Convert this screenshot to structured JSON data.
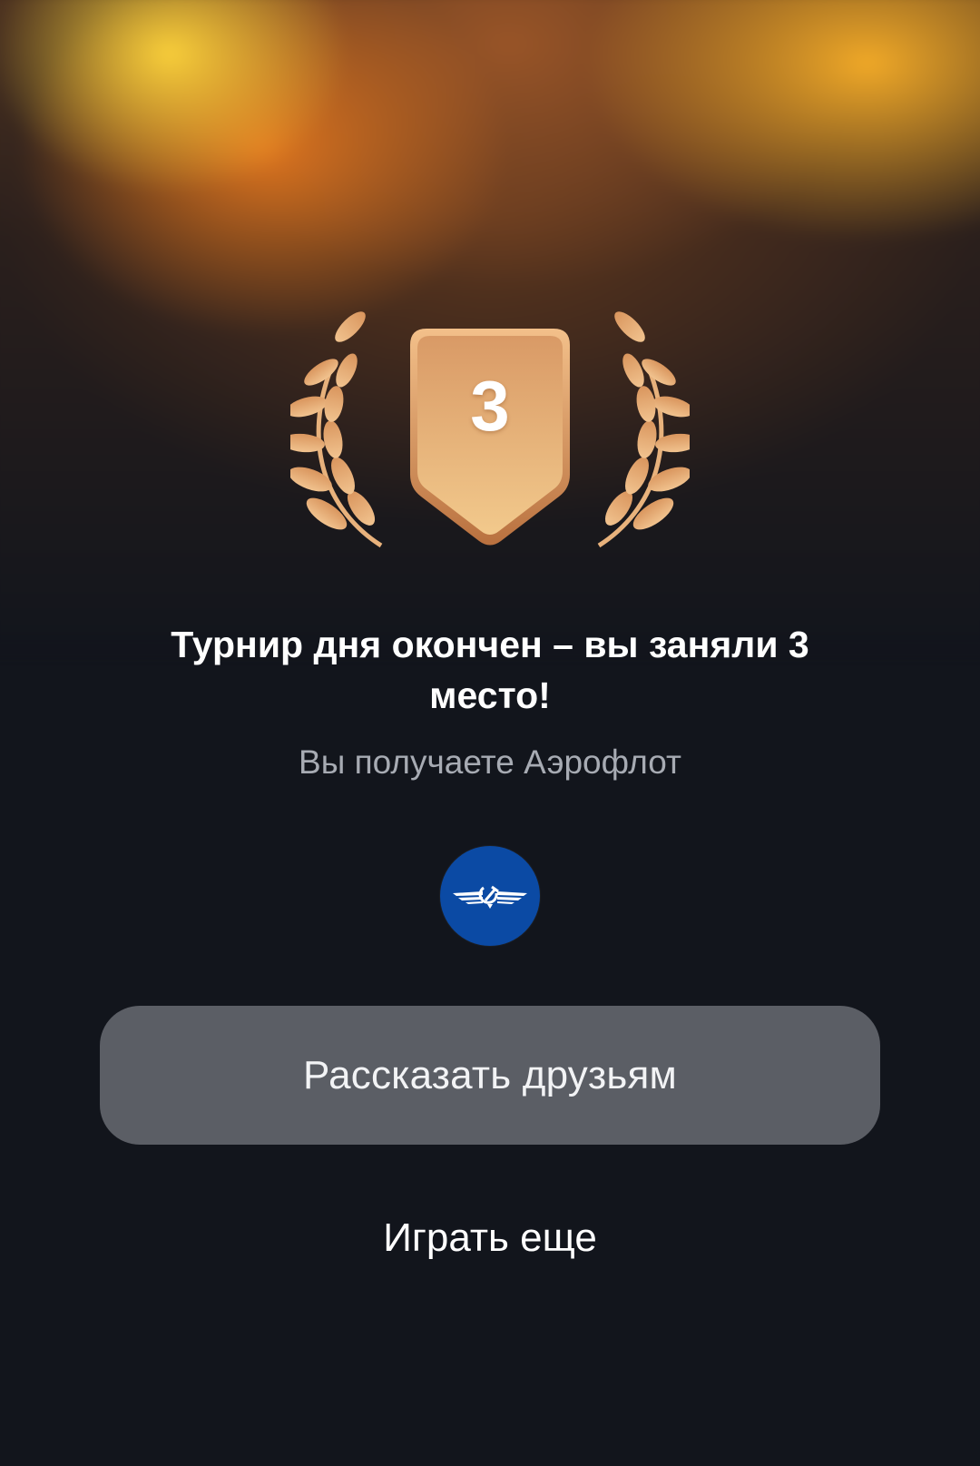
{
  "result": {
    "place": "3",
    "title": "Турнир дня окончен – вы заняли 3 место!",
    "subtitle": "Вы получаете Аэрофлот"
  },
  "reward": {
    "logo_icon": "aeroflot-winged-logo-icon",
    "brand_color": "#0b4aa4"
  },
  "actions": {
    "share_label": "Рассказать друзьям",
    "play_again_label": "Играть еще"
  },
  "colors": {
    "background": "#12151c",
    "medal_bronze": "#e0a063",
    "button_bg": "#5b5e65"
  }
}
